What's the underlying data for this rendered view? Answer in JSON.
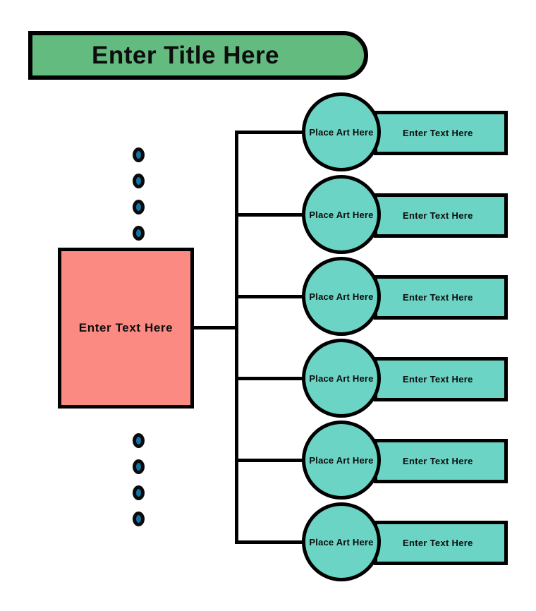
{
  "diagram": {
    "title_banner": {
      "text": "Enter Title Here",
      "fill": "#63BB80",
      "stroke": "#000000"
    },
    "main_node": {
      "text": "Enter Text Here",
      "fill": "#FA8A82",
      "stroke": "#000000"
    },
    "leaf_rows": [
      {
        "circle_label": "Place Art Here",
        "rect_label": "Enter Text Here"
      },
      {
        "circle_label": "Place Art Here",
        "rect_label": "Enter Text Here"
      },
      {
        "circle_label": "Place Art Here",
        "rect_label": "Enter Text Here"
      },
      {
        "circle_label": "Place Art Here",
        "rect_label": "Enter Text Here"
      },
      {
        "circle_label": "Place Art Here",
        "rect_label": "Enter Text Here"
      },
      {
        "circle_label": "Place Art Here",
        "rect_label": "Enter Text Here"
      }
    ],
    "leaf_style": {
      "circle_fill": "#6BD4C4",
      "rect_fill": "#6BD4C4",
      "stroke": "#000000"
    },
    "dot_columns": [
      {
        "name": "upper-ellipsis",
        "count": 4
      },
      {
        "name": "lower-ellipsis",
        "count": 4
      }
    ],
    "dot_style": {
      "fill": "#1273A8",
      "stroke": "#0a0a0a"
    },
    "connector_color": "#000000"
  }
}
